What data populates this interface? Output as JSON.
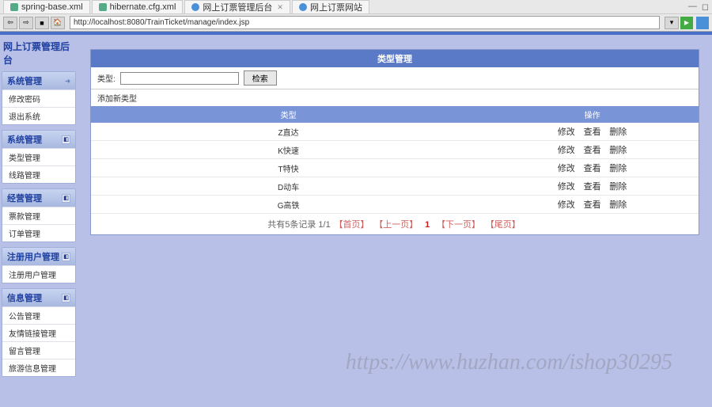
{
  "tabs": [
    {
      "label": "spring-base.xml",
      "iconType": "xml"
    },
    {
      "label": "hibernate.cfg.xml",
      "iconType": "xml"
    },
    {
      "label": "网上订票管理后台",
      "iconType": "web"
    },
    {
      "label": "网上订票网站",
      "iconType": "web"
    }
  ],
  "url": "http://localhost:8080/TrainTicket/manage/index.jsp",
  "appTitle": "网上订票管理后台",
  "sidebar": [
    {
      "title": "系统管理",
      "items": [
        "修改密码",
        "退出系统"
      ],
      "hasArrow": true
    },
    {
      "title": "系统管理",
      "items": [
        "类型管理",
        "线路管理"
      ],
      "hasPin": true
    },
    {
      "title": "经营管理",
      "items": [
        "票款管理",
        "订单管理"
      ],
      "hasPin": true
    },
    {
      "title": "注册用户管理",
      "items": [
        "注册用户管理"
      ],
      "hasPin": true
    },
    {
      "title": "信息管理",
      "items": [
        "公告管理",
        "友情链接管理",
        "留言管理",
        "旅游信息管理"
      ],
      "hasPin": true
    }
  ],
  "panel": {
    "title": "类型管理",
    "searchLabel": "类型:",
    "searchBtn": "检索",
    "addLink": "添加新类型",
    "cols": {
      "type": "类型",
      "ops": "操作"
    },
    "opLabels": {
      "edit": "修改",
      "view": "查看",
      "del": "删除"
    },
    "rows": [
      {
        "type": "Z直达"
      },
      {
        "type": "K快速"
      },
      {
        "type": "T特快"
      },
      {
        "type": "D动车"
      },
      {
        "type": "G高铁"
      }
    ],
    "pagination": {
      "summary": "共有5条记录 1/1",
      "first": "【首页】",
      "prev": "【上一页】",
      "curr": "1",
      "next": "【下一页】",
      "last": "【尾页】"
    }
  },
  "watermark": "https://www.huzhan.com/ishop30295"
}
